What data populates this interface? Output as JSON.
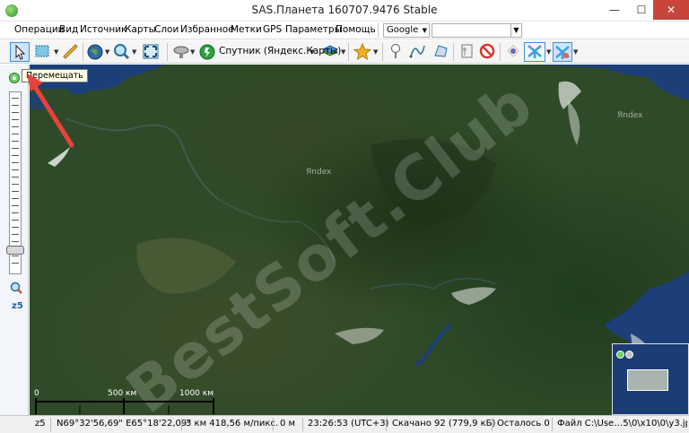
{
  "window": {
    "title": "SAS.Планета 160707.9476 Stable",
    "minimize": "—",
    "maximize": "☐",
    "close": "✕"
  },
  "menu": {
    "items": [
      "Операции",
      "Вид",
      "Источник",
      "Карты",
      "Слои",
      "Избранное",
      "Метки",
      "GPS",
      "Параметры",
      "Помощь"
    ],
    "search_provider": "Google",
    "search_value": ""
  },
  "toolbar": {
    "source_label": "Спутник (Яндекс.Карты)"
  },
  "tooltip": "Перемещать",
  "zoom": {
    "level_label": "z5"
  },
  "map": {
    "watermark": "BestSoft.Club",
    "provider_marks": [
      "Яndex",
      "Яndex"
    ],
    "scale": {
      "zero": "0",
      "mid": "500 км",
      "max": "1000 км"
    },
    "colors": {
      "water": "#1c3f7a",
      "land": "#2f4a28",
      "snow": "#e8ece8",
      "arrow": "#e8423b"
    }
  },
  "status": {
    "zoom": "z5",
    "coords": "N69°32'56,69\" E65°18'22,09\"",
    "resolution": "3 км 418,56 м/пикс.",
    "altitude": "0 м",
    "time": "23:26:53 (UTC+3)",
    "downloaded": "Скачано 92 (779,9 кБ)",
    "remaining": "Осталось 0",
    "file": "Файл C:\\Use…5\\0\\x10\\0\\y3.jpg"
  }
}
